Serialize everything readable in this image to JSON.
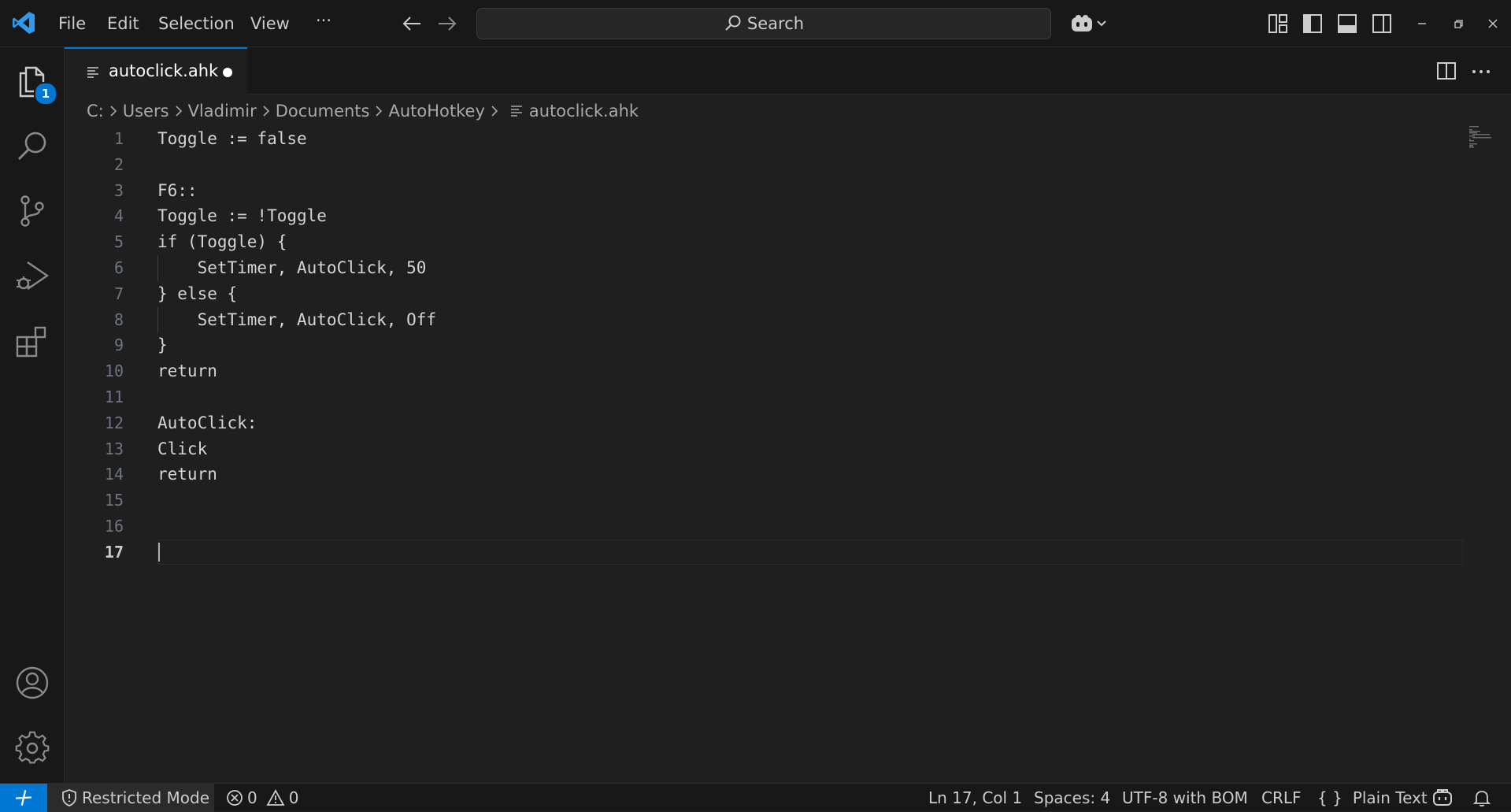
{
  "titlebar": {
    "menu": [
      "File",
      "Edit",
      "Selection",
      "View"
    ],
    "more": "···",
    "search_placeholder": "Search"
  },
  "activity": {
    "explorer_badge": "1"
  },
  "tab": {
    "filename": "autoclick.ahk"
  },
  "breadcrumb": [
    "C:",
    "Users",
    "Vladimir",
    "Documents",
    "AutoHotkey",
    "autoclick.ahk"
  ],
  "editor": {
    "lines": [
      "Toggle := false",
      "",
      "F6::",
      "Toggle := !Toggle",
      "if (Toggle) {",
      "    SetTimer, AutoClick, 50",
      "} else {",
      "    SetTimer, AutoClick, Off",
      "}",
      "return",
      "",
      "AutoClick:",
      "Click",
      "return",
      "",
      "",
      ""
    ],
    "current_line": 17
  },
  "statusbar": {
    "restricted": "Restricted Mode",
    "errors": "0",
    "warnings": "0",
    "position": "Ln 17, Col 1",
    "spaces": "Spaces: 4",
    "encoding": "UTF-8 with BOM",
    "eol": "CRLF",
    "language_glyph": "{ }",
    "language": "Plain Text"
  },
  "colors": {
    "accent": "#0078d4",
    "background": "#1f1f1f",
    "chrome": "#181818"
  }
}
